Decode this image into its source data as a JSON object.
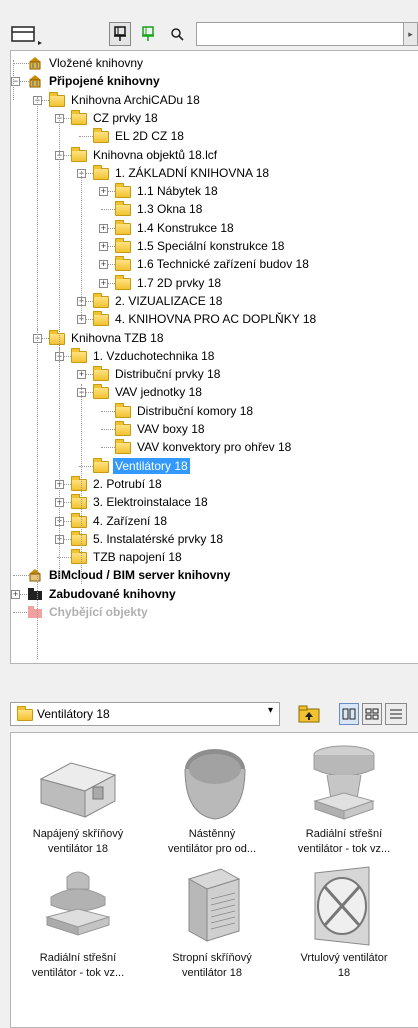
{
  "toolbar": {
    "view_icon": "panel-view-icon",
    "pin1_icon": "pin-icon",
    "pin2_icon": "pin-green-icon",
    "search_icon": "magnifier-icon",
    "search_value": "",
    "search_arrow": "▸"
  },
  "tree": [
    {
      "label": "Vložené knihovny",
      "level": 1,
      "icon": "embedded-library-icon",
      "expander": null
    },
    {
      "label": "Připojené knihovny",
      "level": 1,
      "icon": "linked-library-icon",
      "expander": "−",
      "bold": true
    },
    {
      "label": "Knihovna ArchiCADu 18",
      "level": 2,
      "icon": "folder-icon",
      "expander": "−"
    },
    {
      "label": "CZ prvky 18",
      "level": 3,
      "icon": "folder-icon",
      "expander": "−"
    },
    {
      "label": "EL 2D CZ 18",
      "level": 4,
      "icon": "folder-icon",
      "expander": null
    },
    {
      "label": "Knihovna objektů 18.lcf",
      "level": 3,
      "icon": "folder-icon",
      "expander": "−"
    },
    {
      "label": "1. ZÁKLADNÍ KNIHOVNA 18",
      "level": 4,
      "icon": "folder-icon",
      "expander": "−"
    },
    {
      "label": "1.1 Nábytek 18",
      "level": 5,
      "icon": "folder-icon",
      "expander": "+"
    },
    {
      "label": "1.3 Okna 18",
      "level": 5,
      "icon": "folder-icon",
      "expander": null
    },
    {
      "label": "1.4 Konstrukce 18",
      "level": 5,
      "icon": "folder-icon",
      "expander": "+"
    },
    {
      "label": "1.5 Speciální konstrukce 18",
      "level": 5,
      "icon": "folder-icon",
      "expander": "+"
    },
    {
      "label": "1.6 Technické zařízení budov 18",
      "level": 5,
      "icon": "folder-icon",
      "expander": "+"
    },
    {
      "label": "1.7 2D prvky 18",
      "level": 5,
      "icon": "folder-icon",
      "expander": "+"
    },
    {
      "label": "2. VIZUALIZACE 18",
      "level": 4,
      "icon": "folder-icon",
      "expander": "+"
    },
    {
      "label": "4. KNIHOVNA PRO AC DOPLŇKY 18",
      "level": 4,
      "icon": "folder-icon",
      "expander": "+"
    },
    {
      "label": "Knihovna TZB 18",
      "level": 2,
      "icon": "folder-icon",
      "expander": "−"
    },
    {
      "label": "1. Vzduchotechnika 18",
      "level": 3,
      "icon": "folder-icon",
      "expander": "−"
    },
    {
      "label": "Distribuční prvky 18",
      "level": 4,
      "icon": "folder-icon",
      "expander": "+"
    },
    {
      "label": "VAV jednotky 18",
      "level": 4,
      "icon": "folder-icon",
      "expander": "−"
    },
    {
      "label": "Distribuční komory 18",
      "level": 5,
      "icon": "folder-icon",
      "expander": null
    },
    {
      "label": "VAV boxy 18",
      "level": 5,
      "icon": "folder-icon",
      "expander": null
    },
    {
      "label": "VAV konvektory pro ohřev 18",
      "level": 5,
      "icon": "folder-icon",
      "expander": null
    },
    {
      "label": "Ventilátory 18",
      "level": 4,
      "icon": "folder-icon",
      "expander": null,
      "selected": true
    },
    {
      "label": "2. Potrubí 18",
      "level": 3,
      "icon": "folder-icon",
      "expander": "+"
    },
    {
      "label": "3. Elektroinstalace 18",
      "level": 3,
      "icon": "folder-icon",
      "expander": "+"
    },
    {
      "label": "4. Zařízení 18",
      "level": 3,
      "icon": "folder-icon",
      "expander": "+"
    },
    {
      "label": "5. Instalatérské prvky 18",
      "level": 3,
      "icon": "folder-icon",
      "expander": "+"
    },
    {
      "label": "TZB napojení 18",
      "level": 3,
      "icon": "folder-icon",
      "expander": null
    },
    {
      "label": "BIMcloud / BIM server knihovny",
      "level": 1,
      "icon": "bimcloud-library-icon",
      "expander": null,
      "bold": true
    },
    {
      "label": "Zabudované knihovny",
      "level": 1,
      "icon": "builtin-library-icon",
      "expander": "+",
      "bold": true
    },
    {
      "label": "Chybějící objekty",
      "level": 1,
      "icon": "missing-objects-icon",
      "expander": null,
      "bold": true,
      "grey": true
    }
  ],
  "folder_select": {
    "value": "Ventilátory 18",
    "arrow": "▾"
  },
  "view_buttons": [
    "large-icons-view-icon",
    "small-icons-view-icon",
    "list-view-icon"
  ],
  "objects": [
    {
      "line1": "Napájený skříňový",
      "line2": "ventilátor 18",
      "thumb": "box-fan-icon"
    },
    {
      "line1": "Nástěnný",
      "line2": "ventilátor pro od...",
      "thumb": "wall-fan-icon"
    },
    {
      "line1": "Radiální střešní",
      "line2": "ventilátor - tok vz...",
      "thumb": "roof-fan-icon"
    },
    {
      "line1": "Radiální střešní",
      "line2": "ventilátor - tok vz...",
      "thumb": "roof-fan-2-icon"
    },
    {
      "line1": "Stropní skříňový",
      "line2": "ventilátor 18",
      "thumb": "ceiling-fan-icon"
    },
    {
      "line1": "Vrtulový ventilátor",
      "line2": "18",
      "thumb": "axial-fan-icon"
    }
  ]
}
